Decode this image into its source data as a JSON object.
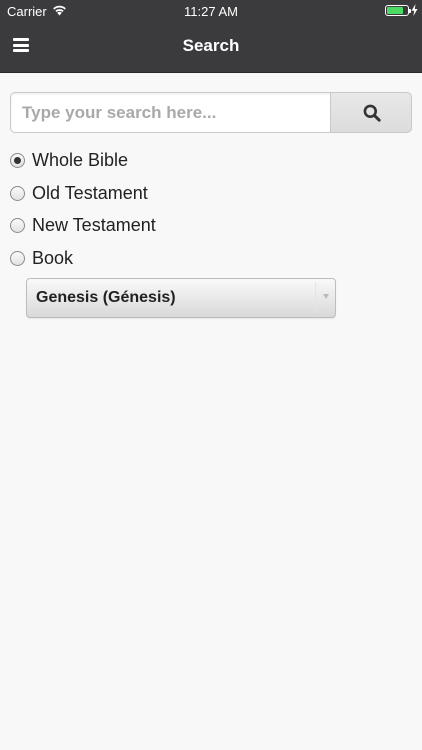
{
  "status_bar": {
    "carrier": "Carrier",
    "time": "11:27 AM",
    "battery_level": 0.8,
    "battery_color": "#4cd964"
  },
  "nav": {
    "title": "Search",
    "menu_icon": "hamburger-menu-icon"
  },
  "search": {
    "placeholder": "Type your search here...",
    "value": "",
    "button_icon": "magnifier-icon"
  },
  "scope_options": [
    {
      "label": "Whole Bible",
      "checked": true
    },
    {
      "label": "Old Testament",
      "checked": false
    },
    {
      "label": "New Testament",
      "checked": false
    },
    {
      "label": "Book",
      "checked": false
    }
  ],
  "book_select": {
    "selected": "Genesis (Génesis)"
  },
  "colors": {
    "bar_background": "#3b3b3e",
    "page_background": "#f8f8f8"
  }
}
